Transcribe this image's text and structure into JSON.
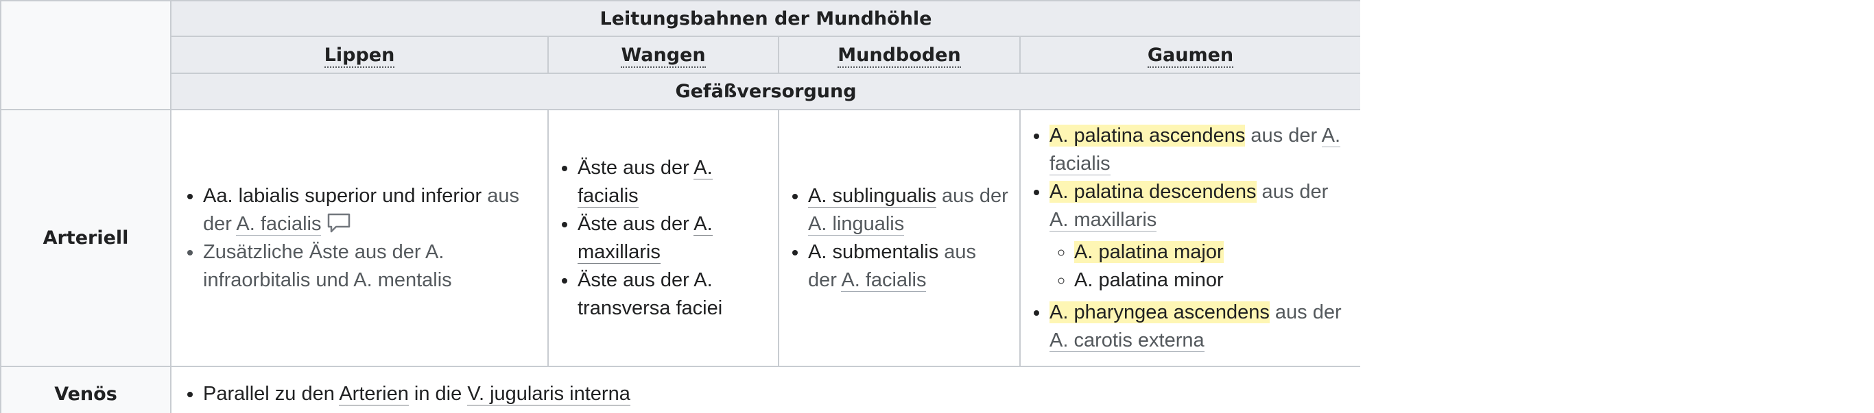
{
  "table": {
    "caption": "Leitungsbahnen der Mundhöhle",
    "columns": [
      "Lippen",
      "Wangen",
      "Mundboden",
      "Gaumen"
    ],
    "section": "Gefäßversorgung",
    "rows": {
      "arteriell": {
        "label": "Arteriell",
        "lippen": {
          "item1_text": "Aa. labialis superior und inferior",
          "item1_mid": " aus der ",
          "item1_link": "A. facialis",
          "comment_icon": "speech-bubble-icon",
          "item2_text": "Zusätzliche Äste aus der A. infraorbitalis und A. mentalis"
        },
        "wangen": {
          "item1_text": "Äste aus der ",
          "item1_link": "A. facialis",
          "item2_text": "Äste aus der ",
          "item2_link": "A. maxillaris",
          "item3_text": "Äste aus der A. transversa faciei"
        },
        "mundboden": {
          "item1_link": "A. sublingualis",
          "item1_mid": " aus der ",
          "item1_link2": "A. lingualis",
          "item2_text": "A. submentalis",
          "item2_mid": " aus der ",
          "item2_link": "A. facialis"
        },
        "gaumen": {
          "item1_hl": "A. palatina ascendens",
          "item1_mid": " aus der ",
          "item1_link": "A. facialis",
          "item2_hl": "A. palatina descendens",
          "item2_mid": " aus der ",
          "item2_link": "A. maxillaris",
          "sub1_hl": "A. palatina major",
          "sub2_text": "A. palatina minor",
          "item3_hl": "A. pharyngea ascendens",
          "item3_mid": " aus der ",
          "item3_link": "A. carotis externa"
        }
      },
      "venoes": {
        "label": "Venös",
        "t1": "Parallel zu den ",
        "l1": "Arterien",
        "t2": " in die ",
        "l2": "V. jugularis interna"
      }
    }
  },
  "colors": {
    "header_bg": "#eaecf0",
    "rowhead_bg": "#f8f9fa",
    "border": "#c8ccd1",
    "highlight": "#fef6b4",
    "muted_text": "#54595d"
  }
}
